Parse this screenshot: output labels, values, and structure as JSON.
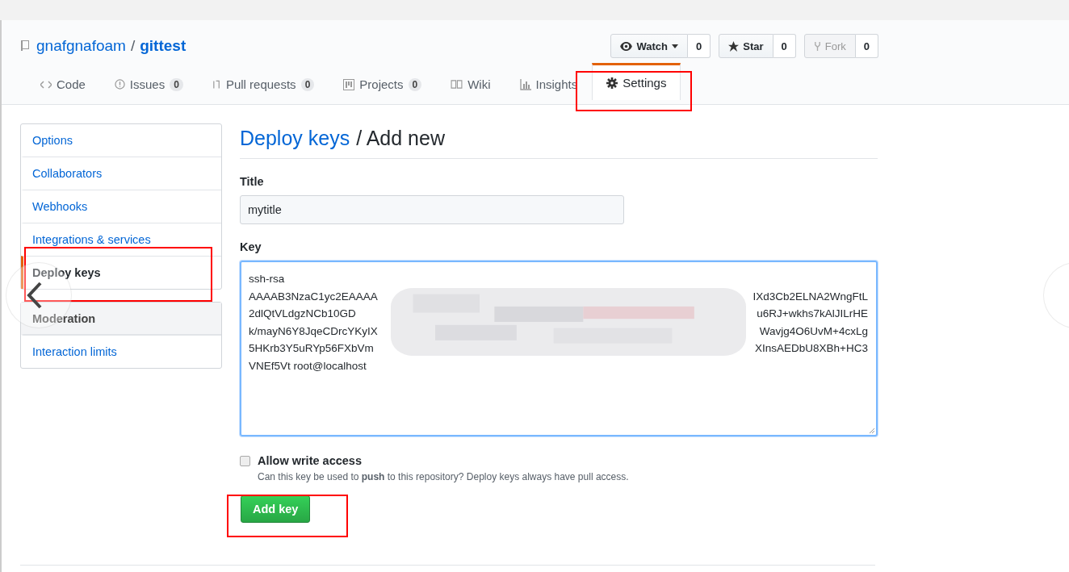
{
  "repo": {
    "owner": "gnafgnafoam",
    "separator": "/",
    "name": "gittest"
  },
  "actions": [
    {
      "label": "Watch",
      "kind": "watch",
      "count": "0",
      "disabled": false
    },
    {
      "label": "Star",
      "kind": "star",
      "count": "0",
      "disabled": false
    },
    {
      "label": "Fork",
      "kind": "fork",
      "count": "0",
      "disabled": true
    }
  ],
  "tabs": [
    {
      "label": "Code",
      "kind": "code",
      "selected": false
    },
    {
      "label": "Issues",
      "kind": "issues",
      "count": "0",
      "selected": false
    },
    {
      "label": "Pull requests",
      "kind": "pr",
      "count": "0",
      "selected": false
    },
    {
      "label": "Projects",
      "kind": "projects",
      "count": "0",
      "selected": false
    },
    {
      "label": "Wiki",
      "kind": "wiki",
      "selected": false
    },
    {
      "label": "Insights",
      "kind": "insights",
      "selected": false
    },
    {
      "label": "Settings",
      "kind": "settings",
      "selected": true
    }
  ],
  "sidebar": {
    "groups": [
      [
        {
          "label": "Options",
          "selected": false
        },
        {
          "label": "Collaborators",
          "selected": false
        },
        {
          "label": "Webhooks",
          "selected": false
        },
        {
          "label": "Integrations & services",
          "selected": false
        },
        {
          "label": "Deploy keys",
          "selected": true
        }
      ],
      [
        {
          "label": "Moderation",
          "kind": "heading",
          "selected": false
        },
        {
          "label": "Interaction limits",
          "selected": false
        }
      ]
    ]
  },
  "heading": {
    "link": "Deploy keys",
    "rest": "/ Add new"
  },
  "title_field": {
    "label": "Title",
    "value": "mytitle"
  },
  "key_field": {
    "label": "Key",
    "lines": [
      {
        "start": "ssh-rsa"
      },
      {
        "start": "AAAAB3NzaC1yc2EAAAA",
        "end": "IXd3Cb2ELNA2WngFtL"
      },
      {
        "start": "2dlQtVLdgzNCb10GD",
        "end": "u6RJ+wkhs7kAlJILrHE"
      },
      {
        "start": "k/mayN6Y8JqeCDrcYKyIX",
        "end": "Wavjg4O6UvM+4cxLg"
      },
      {
        "start": "5HKrb3Y5uRYp56FXbVm",
        "end": "XInsAEDbU8XBh+HC3"
      },
      {
        "start": "VNEf5Vt root@localhost"
      }
    ]
  },
  "write_access": {
    "label": "Allow write access",
    "checked": false,
    "hint": "Can this key be used to **push** to this repository? Deploy keys always have pull access."
  },
  "submit": {
    "label": "Add key"
  }
}
